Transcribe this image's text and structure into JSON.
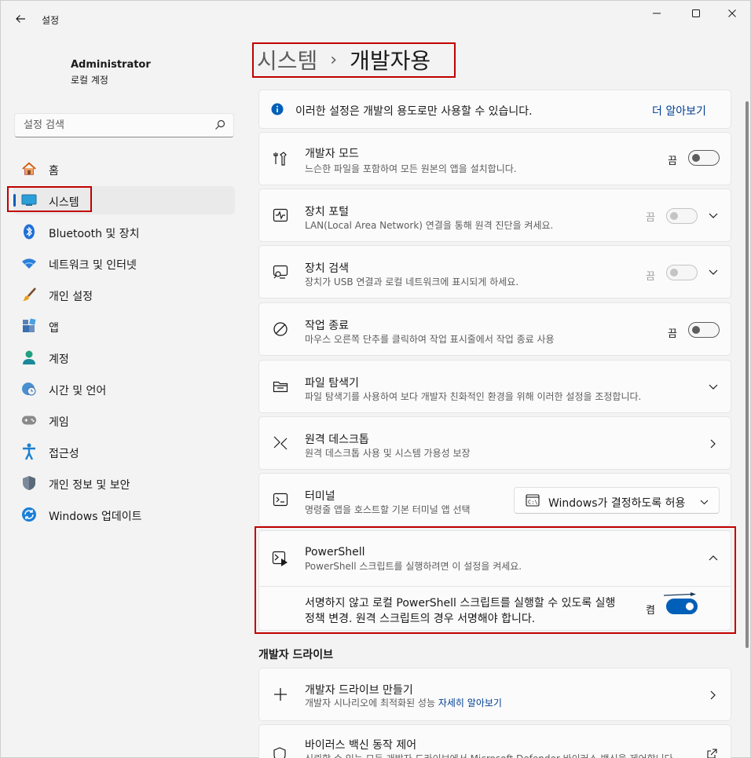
{
  "window": {
    "title": "설정",
    "back_icon": "arrow-left-icon",
    "controls": [
      "minimize-icon",
      "maximize-icon",
      "close-icon"
    ]
  },
  "profile": {
    "name": "Administrator",
    "account_type": "로컬 계정"
  },
  "search": {
    "placeholder": "설정 검색",
    "value": ""
  },
  "sidebar": {
    "items": [
      {
        "label": "홈",
        "icon": "home-icon"
      },
      {
        "label": "시스템",
        "icon": "system-monitor-icon",
        "selected": true
      },
      {
        "label": "Bluetooth 및 장치",
        "icon": "bluetooth-icon"
      },
      {
        "label": "네트워크 및 인터넷",
        "icon": "wifi-icon"
      },
      {
        "label": "개인 설정",
        "icon": "brush-icon"
      },
      {
        "label": "앱",
        "icon": "apps-icon"
      },
      {
        "label": "계정",
        "icon": "person-icon"
      },
      {
        "label": "시간 및 언어",
        "icon": "globe-clock-icon"
      },
      {
        "label": "게임",
        "icon": "gamepad-icon"
      },
      {
        "label": "접근성",
        "icon": "accessibility-icon"
      },
      {
        "label": "개인 정보 및 보안",
        "icon": "shield-icon"
      },
      {
        "label": "Windows 업데이트",
        "icon": "windows-update-icon"
      }
    ]
  },
  "breadcrumb": {
    "parent": "시스템",
    "separator": "›",
    "current": "개발자용"
  },
  "info_bar": {
    "text": "이러한 설정은 개발의 용도로만 사용할 수 있습니다.",
    "link": "더 알아보기"
  },
  "settings": [
    {
      "title": "개발자 모드",
      "subtitle": "느슨한 파일을 포함하여 모든 원본의 앱을 설치합니다.",
      "state": "끔",
      "icon": "developer-tools-icon"
    },
    {
      "title": "장치 포털",
      "subtitle": "LAN(Local Area Network) 연결을 통해 원격 진단을 켜세요.",
      "state": "끔",
      "icon": "device-portal-icon"
    },
    {
      "title": "장치 검색",
      "subtitle": "장치가 USB 연결과 로컬 네트워크에 표시되게 하세요.",
      "state": "끔",
      "icon": "device-discovery-icon"
    },
    {
      "title": "작업 종료",
      "subtitle": "마우스 오른쪽 단추를 클릭하여 작업 표시줄에서 작업 종료 사용",
      "state": "끔",
      "icon": "end-task-icon"
    },
    {
      "title": "파일 탐색기",
      "subtitle": "파일 탐색기를 사용하여 보다 개발자 친화적인 환경을 위해 이러한 설정을 조정합니다.",
      "icon": "folder-icon"
    },
    {
      "title": "원격 데스크톱",
      "subtitle": "원격 데스크톱 사용 및 시스템 가용성 보장",
      "icon": "remote-desktop-icon"
    },
    {
      "title": "터미널",
      "subtitle": "명령줄 앱을 호스트할 기본 터미널 앱 선택",
      "icon": "terminal-icon",
      "dropdown": "Windows가 결정하도록 허용"
    },
    {
      "title": "PowerShell",
      "subtitle": "PowerShell 스크립트를 실행하려면 이 설정을 켜세요.",
      "icon": "powershell-icon",
      "detail": "서명하지 않고 로컬 PowerShell 스크립트를 실행할 수 있도록 실행 정책 변경. 원격 스크립트의 경우 서명해야 합니다.",
      "state": "켬"
    }
  ],
  "dev_drive": {
    "section_title": "개발자 드라이브",
    "items": [
      {
        "title": "개발자 드라이브 만들기",
        "subtitle": "개발자 시나리오에 최적화된 성능",
        "link": "자세히 알아보기",
        "icon": "plus-icon"
      },
      {
        "title": "바이러스 백신 동작 제어",
        "subtitle": "신뢰할 수 있는 모든 개발자 드라이브에서 Microsoft Defender 바이러스 백신을 제어합니다.",
        "icon": "shield-outline-icon"
      }
    ]
  },
  "colors": {
    "accent": "#005fb8",
    "highlight": "#c00000",
    "link": "#003e92"
  }
}
